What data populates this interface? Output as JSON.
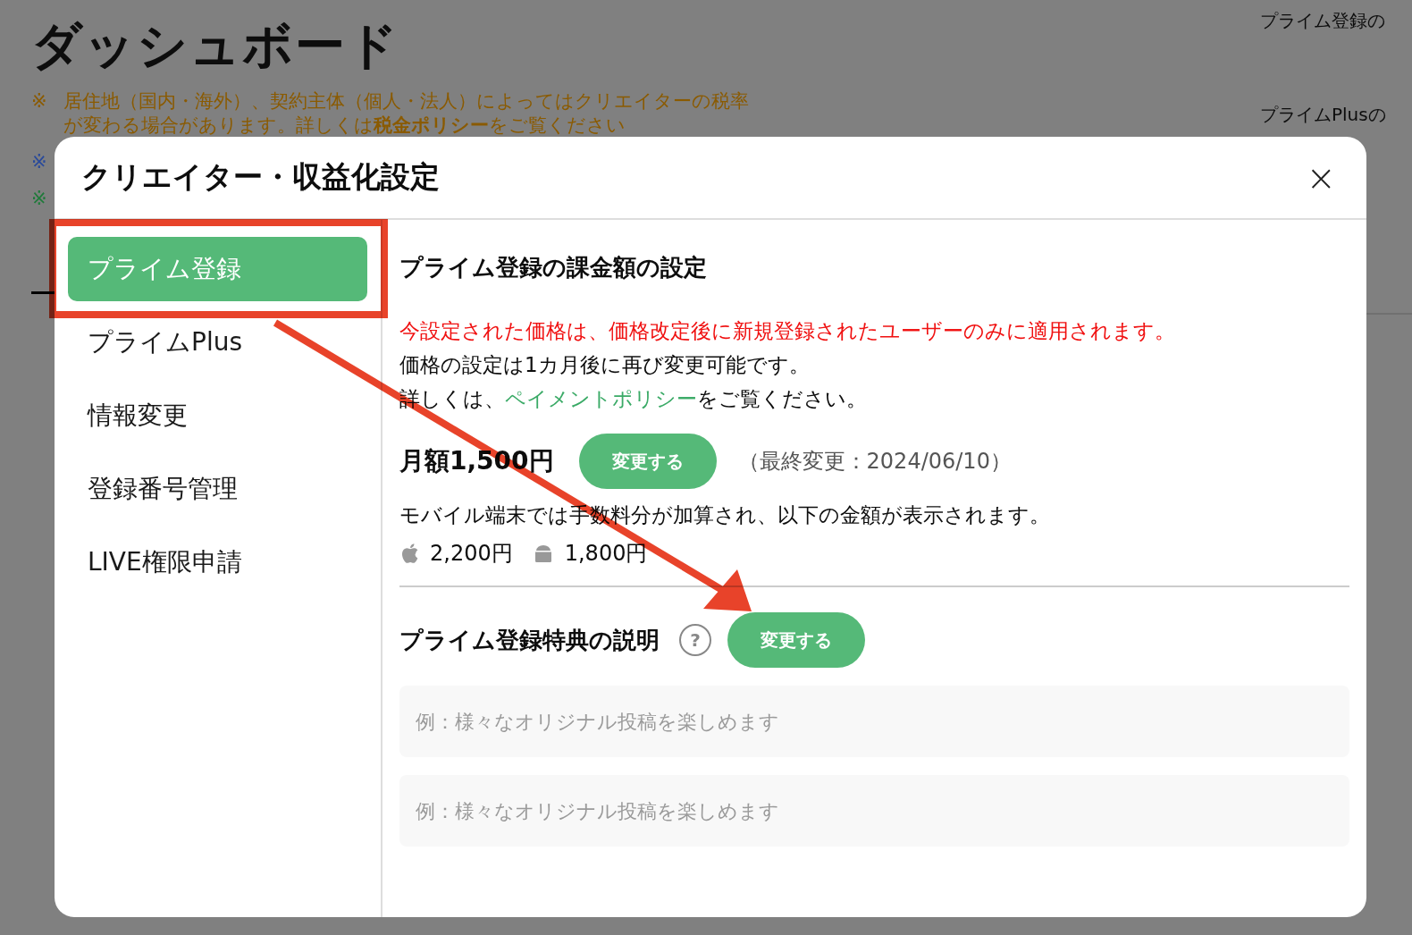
{
  "page": {
    "title": "ダッシュボード",
    "notes": [
      {
        "mark": "※",
        "color": "#8a5a00",
        "lines": [
          "居住地（国内・海外）、契約主体（個人・法人）によってはクリエイターの税率",
          "が変わる場合があります。詳しくは**税金ポリシー**をご覧ください"
        ]
      },
      {
        "mark": "※",
        "color": "#2a4a9a"
      },
      {
        "mark": "※",
        "color": "#1f7a3a"
      }
    ],
    "side_labels": [
      "プライム登録の",
      "プライムPlusの"
    ]
  },
  "dialog": {
    "title": "クリエイター・収益化設定",
    "close": "×",
    "sidebar": {
      "items": [
        {
          "label": "プライム登録",
          "selected": true
        },
        {
          "label": "プライムPlus",
          "selected": false
        },
        {
          "label": "情報変更",
          "selected": false
        },
        {
          "label": "登録番号管理",
          "selected": false
        },
        {
          "label": "LIVE権限申請",
          "selected": false
        }
      ]
    },
    "price_section": {
      "heading": "プライム登録の課金額の設定",
      "warning": "今設定された価格は、価格改定後に新規登録されたユーザーのみに適用されます。",
      "info": "価格の設定は1カ月後に再び変更可能です。",
      "policy": {
        "before": "詳しくは、",
        "link": "ペイメントポリシー",
        "after": "をご覧ください。"
      },
      "price": "月額1,500円",
      "change_button": "変更する",
      "last_changed": "（最終変更：2024/06/10）",
      "mobile_note": "モバイル端末では手数料分が加算され、以下の金額が表示されます。",
      "mobile_prices": [
        {
          "kind": "apple",
          "price": "2,200円"
        },
        {
          "kind": "android",
          "price": "1,800円"
        }
      ]
    },
    "benefit_section": {
      "heading": "プライム登録特典の説明",
      "help": "?",
      "change_button": "変更する",
      "fields": [
        {
          "placeholder": "例：様々なオリジナル投稿を楽しめます"
        },
        {
          "placeholder": "例：様々なオリジナル投稿を楽しめます"
        }
      ]
    }
  }
}
